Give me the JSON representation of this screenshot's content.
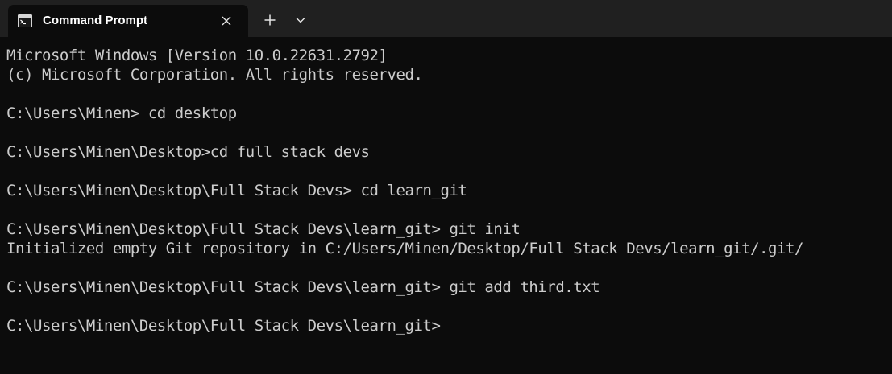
{
  "tab": {
    "title": "Command Prompt",
    "icon": "cmd-icon"
  },
  "tabbar": {
    "close_icon": "close-icon",
    "new_tab_icon": "plus-icon",
    "dropdown_icon": "chevron-down-icon"
  },
  "colors": {
    "background": "#0c0c0c",
    "tabbar": "#202020",
    "text": "#cccccc",
    "tab_title": "#ffffff"
  },
  "terminal": {
    "lines": [
      "Microsoft Windows [Version 10.0.22631.2792]",
      "(c) Microsoft Corporation. All rights reserved.",
      "",
      "C:\\Users\\Minen> cd desktop",
      "",
      "C:\\Users\\Minen\\Desktop>cd full stack devs",
      "",
      "C:\\Users\\Minen\\Desktop\\Full Stack Devs> cd learn_git",
      "",
      "C:\\Users\\Minen\\Desktop\\Full Stack Devs\\learn_git> git init",
      "Initialized empty Git repository in C:/Users/Minen/Desktop/Full Stack Devs/learn_git/.git/",
      "",
      "C:\\Users\\Minen\\Desktop\\Full Stack Devs\\learn_git> git add third.txt",
      "",
      "C:\\Users\\Minen\\Desktop\\Full Stack Devs\\learn_git>"
    ]
  }
}
